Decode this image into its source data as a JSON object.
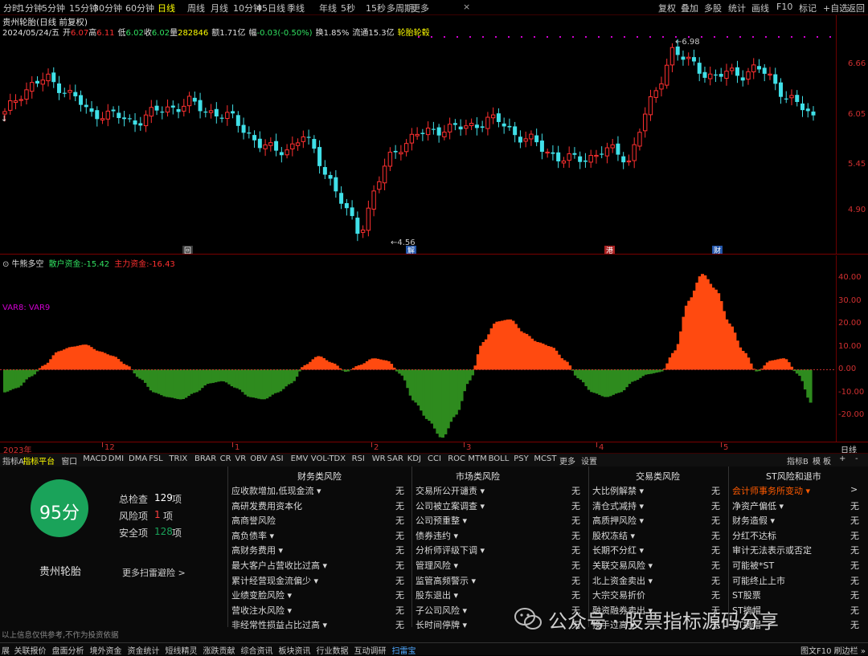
{
  "toolbar": {
    "periods": [
      "分时",
      "1分钟",
      "5分钟",
      "15分钟",
      "30分钟",
      "60分钟",
      "日线",
      "周线",
      "月线",
      "10分钟",
      "45日线",
      "季线",
      "年线",
      "5秒",
      "15秒",
      "多周期",
      "更多"
    ],
    "active": "日线",
    "right": [
      "复权",
      "叠加",
      "多股",
      "统计",
      "画线",
      "F10",
      "标记",
      "+自选",
      "返回"
    ]
  },
  "stock": {
    "title": "贵州轮胎(日线 前复权)",
    "date": "2024/05/24/五",
    "open_label": "开",
    "open": "6.07",
    "high_label": "高",
    "high": "6.11",
    "low_label": "低",
    "low": "6.02",
    "close_label": "收",
    "close": "6.02",
    "vol_label": "量",
    "vol": "282846",
    "amount_label": "额",
    "amount": "1.71亿",
    "change_label": "幅",
    "change": "-0.03(-0.50%)",
    "turnover": "换1.85%",
    "float_cap": "流通15.3亿",
    "name": "轮胎轮毂"
  },
  "main_chart": {
    "price_labels": [
      "6.66",
      "6.05",
      "5.45",
      "4.90"
    ],
    "high_mark": "6.98",
    "low_mark": "4.56",
    "left_mark": "↓",
    "event_badges": [
      "回",
      "解",
      "港",
      "财"
    ]
  },
  "indicator": {
    "name": "牛熊多空",
    "retail_label": "散户资金:",
    "retail_value": "-15.42",
    "main_label": "主力资金:",
    "main_value": "-16.43",
    "var_label": "VAR8: VAR9",
    "y_labels": [
      "40.00",
      "30.00",
      "20.00",
      "10.00",
      "0.00",
      "-10.00",
      "-20.00"
    ]
  },
  "time_axis": {
    "labels": [
      "2023年",
      "12",
      "1",
      "2",
      "3",
      "4",
      "5"
    ],
    "period": "日线"
  },
  "chart_data": [
    {
      "type": "candlestick",
      "title": "贵州轮胎(日线 前复权)",
      "ylim": [
        4.56,
        6.98
      ],
      "x": [
        "2023-11",
        "2023-12",
        "2024-01",
        "2024-02",
        "2024-03",
        "2024-04",
        "2024-05"
      ],
      "close_path": [
        6.05,
        6.3,
        6.42,
        6.48,
        6.38,
        6.25,
        6.05,
        6.08,
        6.02,
        5.95,
        6.05,
        6.1,
        6.15,
        6.2,
        6.1,
        6.08,
        6.0,
        5.85,
        5.7,
        5.6,
        5.65,
        5.8,
        5.55,
        5.25,
        4.9,
        4.62,
        5.1,
        5.5,
        5.7,
        5.8,
        5.85,
        5.9,
        5.88,
        5.92,
        6.0,
        5.95,
        5.82,
        5.75,
        5.62,
        5.55,
        5.5,
        5.52,
        5.62,
        5.6,
        5.5,
        6.0,
        6.35,
        6.85,
        6.7,
        6.6,
        6.5,
        6.55,
        6.55,
        6.62,
        6.48,
        6.3,
        6.15,
        6.02
      ]
    },
    {
      "type": "area",
      "title": "牛熊多空",
      "ylim": [
        -30,
        45
      ],
      "series": [
        {
          "name": "散户资金",
          "values": [
            -10,
            -8,
            -3,
            2,
            8,
            10,
            11,
            8,
            6,
            2,
            -4,
            -10,
            -12,
            -13,
            -10,
            -6,
            -5,
            -8,
            -12,
            -13,
            -10,
            -6,
            2,
            6,
            3,
            -1,
            2,
            5,
            4,
            -2,
            -14,
            -22,
            -30,
            -20,
            -5,
            12,
            21,
            22,
            16,
            12,
            10,
            4,
            -4,
            -10,
            -12,
            -10,
            -5,
            -2,
            -1,
            8,
            30,
            42,
            35,
            20,
            8,
            -1,
            4,
            5,
            -2,
            -15
          ]
        },
        {
          "name": "主力资金",
          "values": [
            -12,
            -9,
            -4,
            1,
            7,
            9,
            10,
            7,
            5,
            1,
            -5,
            -11,
            -13,
            -14,
            -11,
            -7,
            -6,
            -9,
            -13,
            -14,
            -11,
            -7,
            1,
            5,
            2,
            -2,
            1,
            4,
            3,
            -3,
            -15,
            -24,
            -32,
            -22,
            -6,
            11,
            20,
            21,
            15,
            11,
            9,
            3,
            -5,
            -11,
            -13,
            -11,
            -6,
            -3,
            -2,
            7,
            28,
            40,
            33,
            18,
            7,
            -2,
            3,
            4,
            -3,
            -16
          ]
        }
      ]
    }
  ],
  "tabs": [
    "指标A",
    "指标平台",
    "窗口",
    "MACD",
    "DMI",
    "DMA",
    "FSL",
    "TRIX",
    "BRAR",
    "CR",
    "VR",
    "OBV",
    "ASI",
    "EMV",
    "VOL-TDX",
    "RSI",
    "WR",
    "SAR",
    "KDJ",
    "CCI",
    "ROC",
    "MTM",
    "BOLL",
    "PSY",
    "MCST",
    "更多",
    "设置"
  ],
  "tab_active": "指标平台",
  "tab_right": [
    "指标B",
    "模",
    "板",
    "+",
    "-"
  ],
  "score_panel": {
    "score": "95分",
    "stock_name": "贵州轮胎",
    "total_label": "总检查",
    "total_value": "129",
    "total_unit": "项",
    "risk_label": "风险项",
    "risk_value": "1",
    "risk_unit": "项",
    "safe_label": "安全项",
    "safe_value": "128",
    "safe_unit": "项",
    "more": "更多扫雷避险 >",
    "disclaimer": "以上信息仅供参考,不作为投资依据",
    "accent": "#1aa35a"
  },
  "risk_columns": [
    {
      "title": "财务类风险",
      "items": [
        {
          "label": "应收款增加,低现金流 ▾",
          "value": "无"
        },
        {
          "label": "高研发费用资本化",
          "value": "无"
        },
        {
          "label": "高商誉风险",
          "value": "无"
        },
        {
          "label": "高负债率 ▾",
          "value": "无"
        },
        {
          "label": "高财务费用 ▾",
          "value": "无"
        },
        {
          "label": "最大客户占营收比过高 ▾",
          "value": "无"
        },
        {
          "label": "累计经营现金流偏少 ▾",
          "value": "无"
        },
        {
          "label": "业绩变脸风险 ▾",
          "value": "无"
        },
        {
          "label": "营收注水风险 ▾",
          "value": "无"
        },
        {
          "label": "非经常性损益占比过高 ▾",
          "value": "无"
        }
      ]
    },
    {
      "title": "市场类风险",
      "items": [
        {
          "label": "交易所公开谴责 ▾",
          "value": "无"
        },
        {
          "label": "公司被立案调查 ▾",
          "value": "无"
        },
        {
          "label": "公司预重整 ▾",
          "value": "无"
        },
        {
          "label": "债券违约 ▾",
          "value": "无"
        },
        {
          "label": "分析师评级下调 ▾",
          "value": "无"
        },
        {
          "label": "管理风险 ▾",
          "value": "无"
        },
        {
          "label": "监管高频警示 ▾",
          "value": "无"
        },
        {
          "label": "股东退出 ▾",
          "value": "无"
        },
        {
          "label": "子公司风险 ▾",
          "value": "无"
        },
        {
          "label": "长时间停牌 ▾",
          "value": "无"
        }
      ]
    },
    {
      "title": "交易类风险",
      "items": [
        {
          "label": "大比例解禁 ▾",
          "value": "无"
        },
        {
          "label": "清仓式减持 ▾",
          "value": "无"
        },
        {
          "label": "高质押风险 ▾",
          "value": "无"
        },
        {
          "label": "股权冻结 ▾",
          "value": "无"
        },
        {
          "label": "长期不分红 ▾",
          "value": "无"
        },
        {
          "label": "关联交易风险 ▾",
          "value": "无"
        },
        {
          "label": "北上资金卖出 ▾",
          "value": "无"
        },
        {
          "label": "大宗交易折价",
          "value": "无"
        },
        {
          "label": "融资融券卖出 ▾",
          "value": "无"
        },
        {
          "label": "换手过高 ▾",
          "value": "无"
        }
      ]
    },
    {
      "title": "ST风险和退市",
      "items": [
        {
          "label": "会计师事务所变动 ▾",
          "value": ">",
          "risk": true
        },
        {
          "label": "净资产偏低 ▾",
          "value": "无"
        },
        {
          "label": "财务造假 ▾",
          "value": "无"
        },
        {
          "label": "分红不达标",
          "value": "无"
        },
        {
          "label": "审计无法表示或否定",
          "value": "无"
        },
        {
          "label": "可能被*ST",
          "value": "无"
        },
        {
          "label": "可能终止上市",
          "value": "无"
        },
        {
          "label": "ST股票",
          "value": "无"
        },
        {
          "label": "ST摘帽",
          "value": "无"
        },
        {
          "label": "ST摘帽",
          "value": "无"
        }
      ]
    }
  ],
  "watermark": "公众号 · 股票指标源码分享",
  "footer": {
    "items": [
      "展",
      "关联报价",
      "盘面分析",
      "境外资金",
      "资金统计",
      "短线精灵",
      "涨跌贡献",
      "综合资讯",
      "板块资讯",
      "行业数据",
      "互动调研",
      "扫雷宝"
    ],
    "active": "扫雷宝",
    "right": "图文F10 刷边栏 »"
  },
  "colors": {
    "up": "#ff3030",
    "down": "#40e0e8",
    "bull": "#ff4a10",
    "bear": "#2e8b1e",
    "accent_yellow": "#ffff00",
    "risk_text": "#ff5a00"
  }
}
